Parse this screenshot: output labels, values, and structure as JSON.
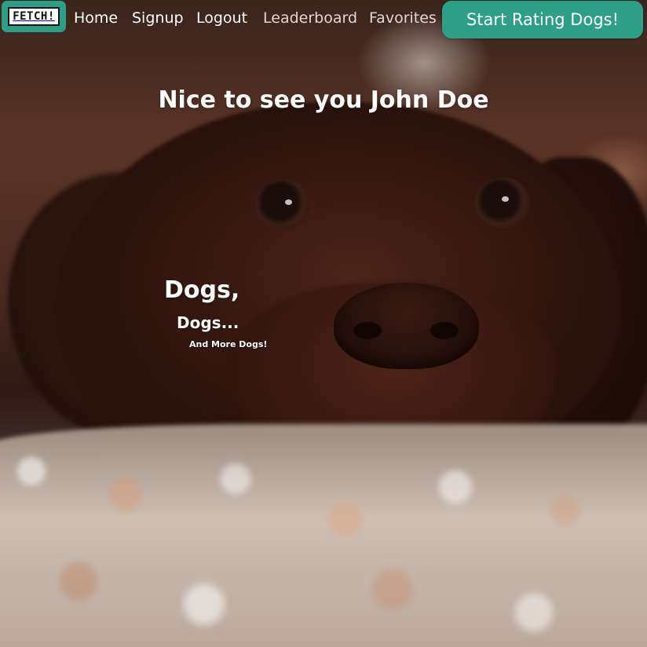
{
  "nav": {
    "logo_text": "FETCH!",
    "links": [
      {
        "label": "Home"
      },
      {
        "label": "Signup"
      },
      {
        "label": "Logout"
      },
      {
        "label": "Leaderboard"
      },
      {
        "label": "Favorites"
      }
    ],
    "cta_label": "Start Rating Dogs!"
  },
  "hero": {
    "welcome": "Nice to see you John Doe",
    "tagline": {
      "line1": "Dogs,",
      "line2": "Dogs...",
      "line3": "And More Dogs!"
    }
  },
  "colors": {
    "accent": "#2c9f86",
    "text": "#ffffff"
  },
  "icons": {
    "logo": "fetch-logo"
  }
}
